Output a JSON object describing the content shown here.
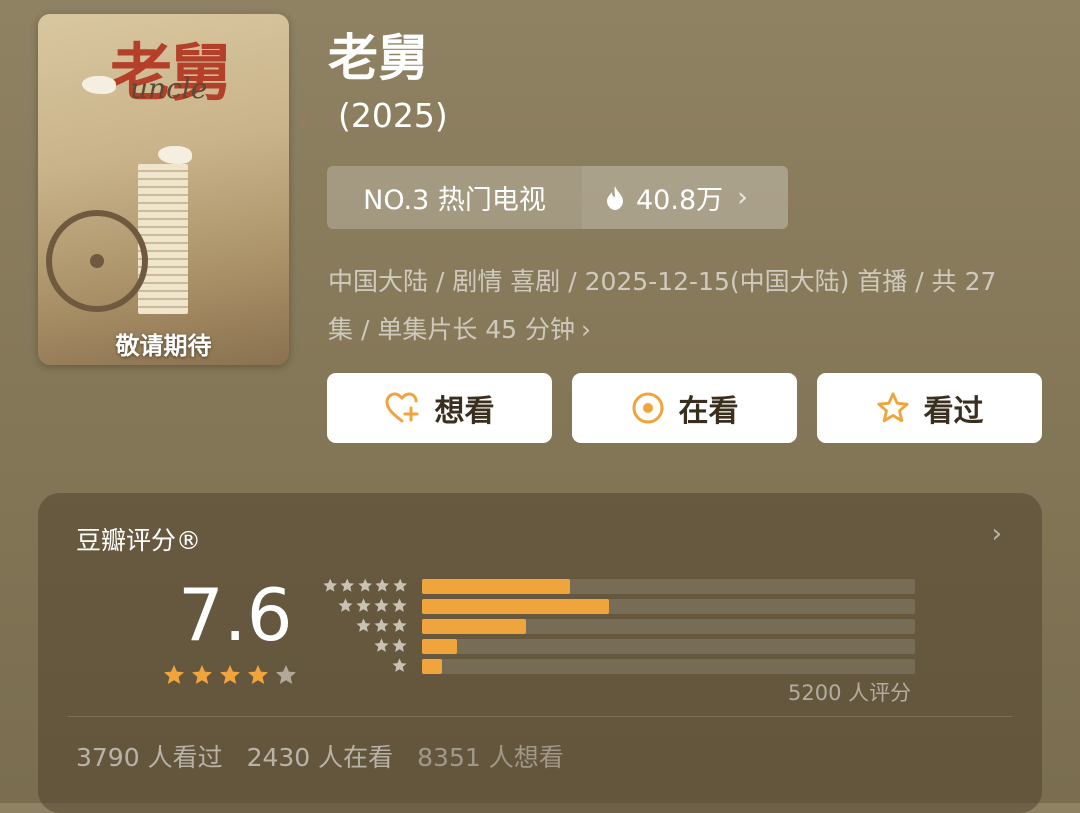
{
  "poster": {
    "title": "老舅",
    "subtitle": "uncle",
    "tagline": "敬请期待"
  },
  "show": {
    "title": "老舅",
    "year": "(2025)"
  },
  "rank": {
    "label": "NO.3 热门电视",
    "heat": "40.8万",
    "chevron": "›"
  },
  "meta": {
    "line1": "中国大陆 / 剧情 喜剧 / 2025-12-15(中国大陆) 首播 / 共 27",
    "line2": "集 / 单集片长 45 分钟",
    "chevron": "›"
  },
  "actions": {
    "want": "想看",
    "watching": "在看",
    "watched": "看过"
  },
  "rating": {
    "header": "豆瓣评分®",
    "chevron": "›",
    "score": "7.6",
    "stars_filled": 4,
    "stars_total": 5,
    "distribution": [
      {
        "stars": 5,
        "fraction": 0.3
      },
      {
        "stars": 4,
        "fraction": 0.38
      },
      {
        "stars": 3,
        "fraction": 0.21
      },
      {
        "stars": 2,
        "fraction": 0.07
      },
      {
        "stars": 1,
        "fraction": 0.04
      }
    ],
    "count_text": "5200 人评分"
  },
  "stats": {
    "watched": "3790 人看过",
    "watching": "2430 人在看",
    "want": "8351 人想看"
  },
  "colors": {
    "accent": "#f0a53c",
    "background": "#857858",
    "star_empty": "#b3a99a"
  },
  "icons": {
    "heat": "flame-icon",
    "want": "heart-plus-icon",
    "watching": "target-circle-icon",
    "watched": "star-outline-icon"
  }
}
